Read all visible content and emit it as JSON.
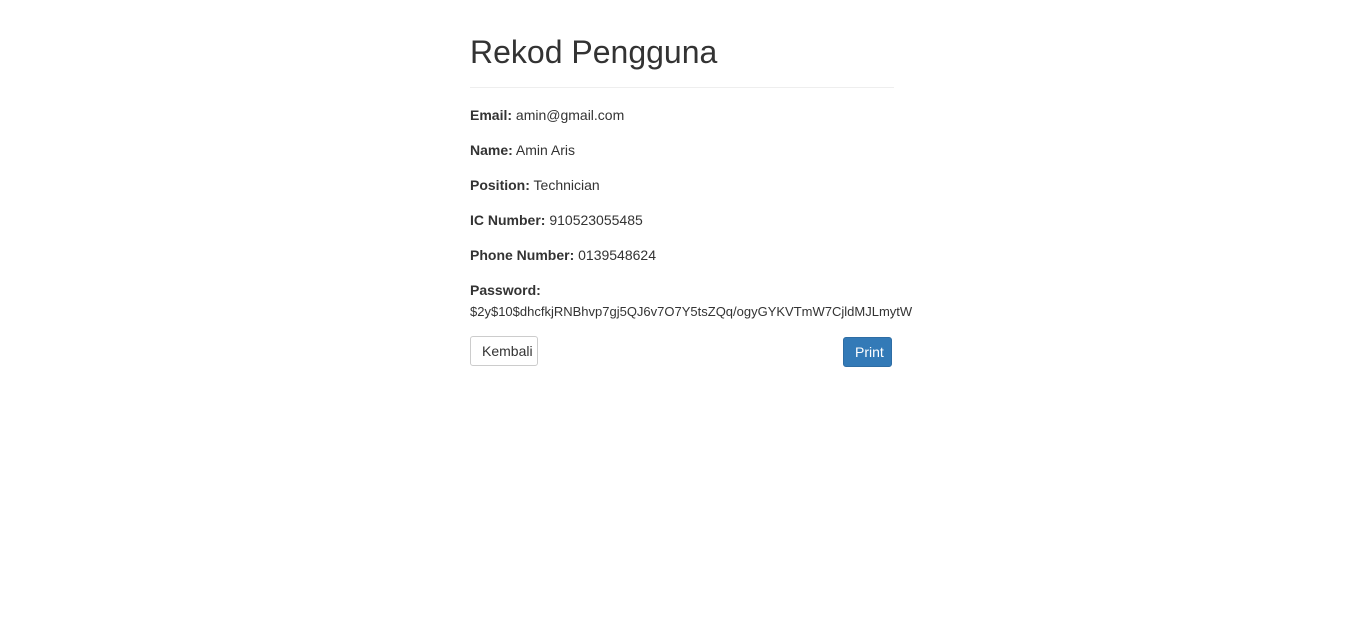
{
  "page": {
    "title": "Rekod Pengguna"
  },
  "records": {
    "email": {
      "label": "Email:",
      "value": "amin@gmail.com"
    },
    "name": {
      "label": "Name:",
      "value": "Amin Aris"
    },
    "position": {
      "label": "Position:",
      "value": "Technician"
    },
    "ic_number": {
      "label": "IC Number:",
      "value": "910523055485"
    },
    "phone_number": {
      "label": "Phone Number:",
      "value": "0139548624"
    },
    "password": {
      "label": "Password:",
      "value": "$2y$10$dhcfkjRNBhvp7gj5QJ6v7O7Y5tsZQq/ogyGYKVTmW7CjldMJLmytW"
    }
  },
  "actions": {
    "back_label": "Kembali",
    "print_label": "Print"
  },
  "colors": {
    "primary": "#337ab7",
    "text": "#333333",
    "divider": "#eeeeee"
  }
}
